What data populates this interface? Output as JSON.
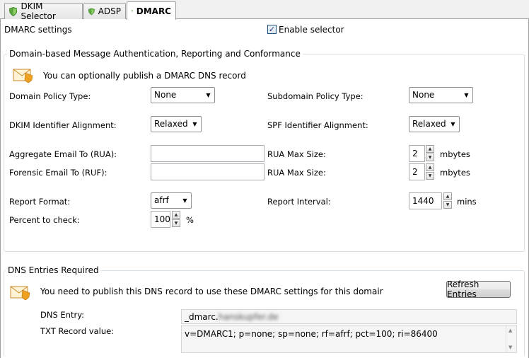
{
  "tabs": [
    {
      "label": "DKIM Selector"
    },
    {
      "label": "ADSP"
    },
    {
      "label": "DMARC"
    }
  ],
  "header": {
    "title": "DMARC settings",
    "enable_label": "Enable selector",
    "enable_checked": true
  },
  "dmarc_group": {
    "legend": "Domain-based Message Authentication, Reporting and Conformance",
    "info_text": "You can optionally publish a DMARC DNS record",
    "domain_policy_label": "Domain Policy Type:",
    "domain_policy_value": "None",
    "subdomain_policy_label": "Subdomain Policy Type:",
    "subdomain_policy_value": "None",
    "dkim_align_label": "DKIM Identifier Alignment:",
    "dkim_align_value": "Relaxed",
    "spf_align_label": "SPF Identifier Alignment:",
    "spf_align_value": "Relaxed",
    "rua_label": "Aggregate Email To (RUA):",
    "rua_value": "",
    "ruf_label": "Forensic Email To (RUF):",
    "ruf_value": "",
    "rua_max_label_1": "RUA Max Size:",
    "rua_max_value_1": "2",
    "rua_max_unit_1": "mbytes",
    "rua_max_label_2": "RUA Max Size:",
    "rua_max_value_2": "2",
    "rua_max_unit_2": "mbytes",
    "report_format_label": "Report Format:",
    "report_format_value": "afrf",
    "report_interval_label": "Report Interval:",
    "report_interval_value": "1440",
    "report_interval_unit": "mins",
    "percent_label": "Percent to check:",
    "percent_value": "100",
    "percent_unit": "%"
  },
  "dns_group": {
    "legend": "DNS Entries Required",
    "info_text": "You need to publish this DNS record to use these DMARC settings for this domair",
    "refresh_label": "Refresh Entries",
    "dns_entry_label": "DNS Entry:",
    "dns_entry_prefix": "_dmarc.",
    "dns_entry_domain": "hanskupfer.de",
    "txt_label": "TXT Record value:",
    "txt_value": "v=DMARC1; p=none; sp=none; rf=afrf; pct=100; ri=86400"
  },
  "colors": {
    "group_border": "#d5dfe5",
    "shield_green": "#5aa53c",
    "envelope_orange": "#f0a020"
  }
}
